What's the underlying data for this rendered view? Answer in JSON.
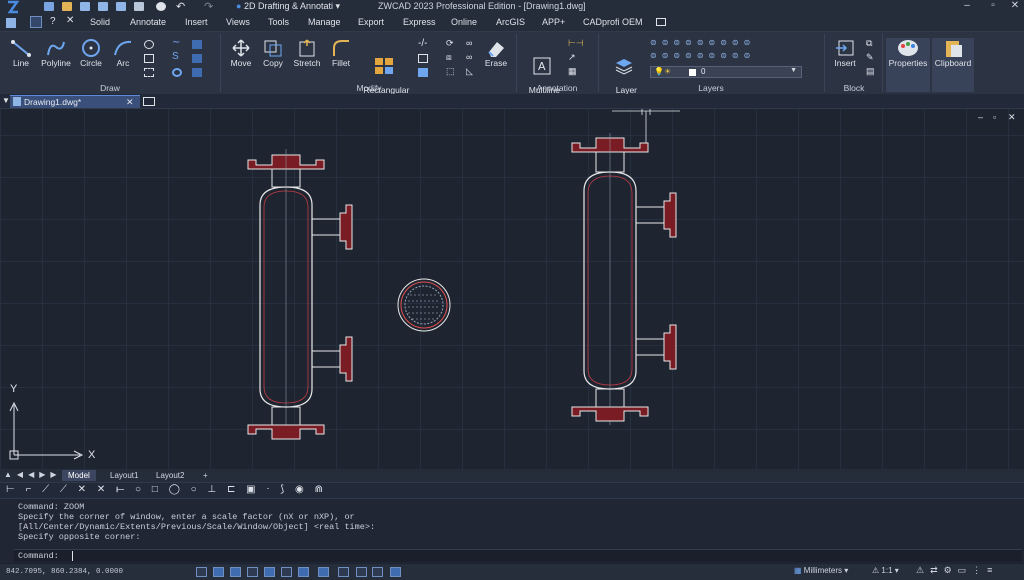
{
  "app": {
    "title": "ZWCAD 2023 Professional Edition - [Drawing1.dwg]",
    "workspace": "2D Drafting & Annotati"
  },
  "menu_tabs": [
    "Solid",
    "Annotate",
    "Insert",
    "Views",
    "Tools",
    "Manage",
    "Export",
    "Express",
    "Online",
    "ArcGIS",
    "APP+",
    "CADprofi OEM"
  ],
  "ribbon": {
    "draw": {
      "label": "Draw",
      "buttons": [
        "Line",
        "Polyline",
        "Circle",
        "Arc"
      ]
    },
    "modify": {
      "label": "Modify",
      "buttons": [
        "Move",
        "Copy",
        "Stretch",
        "Fillet",
        "Rectangular\nArray",
        "Erase"
      ]
    },
    "annotation": {
      "label": "Annotation",
      "buttons": [
        "Multiline\nText"
      ]
    },
    "layers": {
      "label": "Layers",
      "buttons": [
        "Layer\nProperties"
      ],
      "current_layer": "0"
    },
    "block": {
      "label": "Block",
      "buttons": [
        "Insert"
      ]
    },
    "properties_label": "Properties",
    "clipboard_label": "Clipboard"
  },
  "document": {
    "tab_title": "Drawing1.dwg*"
  },
  "axes": {
    "x": "X",
    "y": "Y"
  },
  "layout_tabs": [
    "Model",
    "Layout1",
    "Layout2",
    "+"
  ],
  "command_history": [
    "Command: ZOOM",
    "Specify the corner of window, enter a scale factor (nX or nXP), or",
    "[All/Center/Dynamic/Extents/Previous/Scale/Window/Object] <real time>:",
    "Specify opposite corner:"
  ],
  "command_prompt": "Command:",
  "status": {
    "coordinates": "842.7095, 860.2384, 0.0000",
    "units": "Millimeters",
    "scale": "1:1"
  },
  "colors": {
    "accent": "#4a7fd1",
    "flange": "#7a1c24",
    "outline": "#e8e8e8"
  }
}
